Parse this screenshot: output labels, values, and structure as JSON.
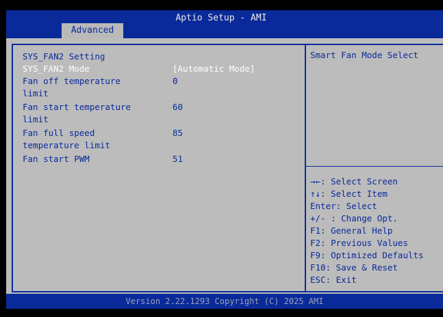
{
  "app_title": "Aptio Setup - AMI",
  "tab": "Advanced",
  "section_title": "SYS_FAN2 Setting",
  "items": [
    {
      "label_lines": [
        "SYS_FAN2 Mode"
      ],
      "value": "[Automatic Mode]",
      "selected": true
    },
    {
      "label_lines": [
        "Fan off temperature",
        "limit"
      ],
      "value": "0",
      "selected": false
    },
    {
      "label_lines": [
        "Fan start temperature",
        "limit"
      ],
      "value": "60",
      "selected": false
    },
    {
      "label_lines": [
        "Fan full speed",
        "temperature limit"
      ],
      "value": "85",
      "selected": false
    },
    {
      "label_lines": [
        "Fan start PWM"
      ],
      "value": "51",
      "selected": false
    }
  ],
  "help": "Smart Fan Mode Select",
  "keys": [
    "→←: Select Screen",
    "↑↓: Select Item",
    "Enter: Select",
    "+/- : Change Opt.",
    "F1: General Help",
    "F2: Previous Values",
    "F9: Optimized Defaults",
    "F10: Save & Reset",
    "ESC: Exit"
  ],
  "footer": "Version 2.22.1293 Copyright (C) 2025 AMI",
  "colors": {
    "bios_blue": "#0a2a9a",
    "panel_gray": "#bcbcbc",
    "selected_text": "#ffffff"
  }
}
